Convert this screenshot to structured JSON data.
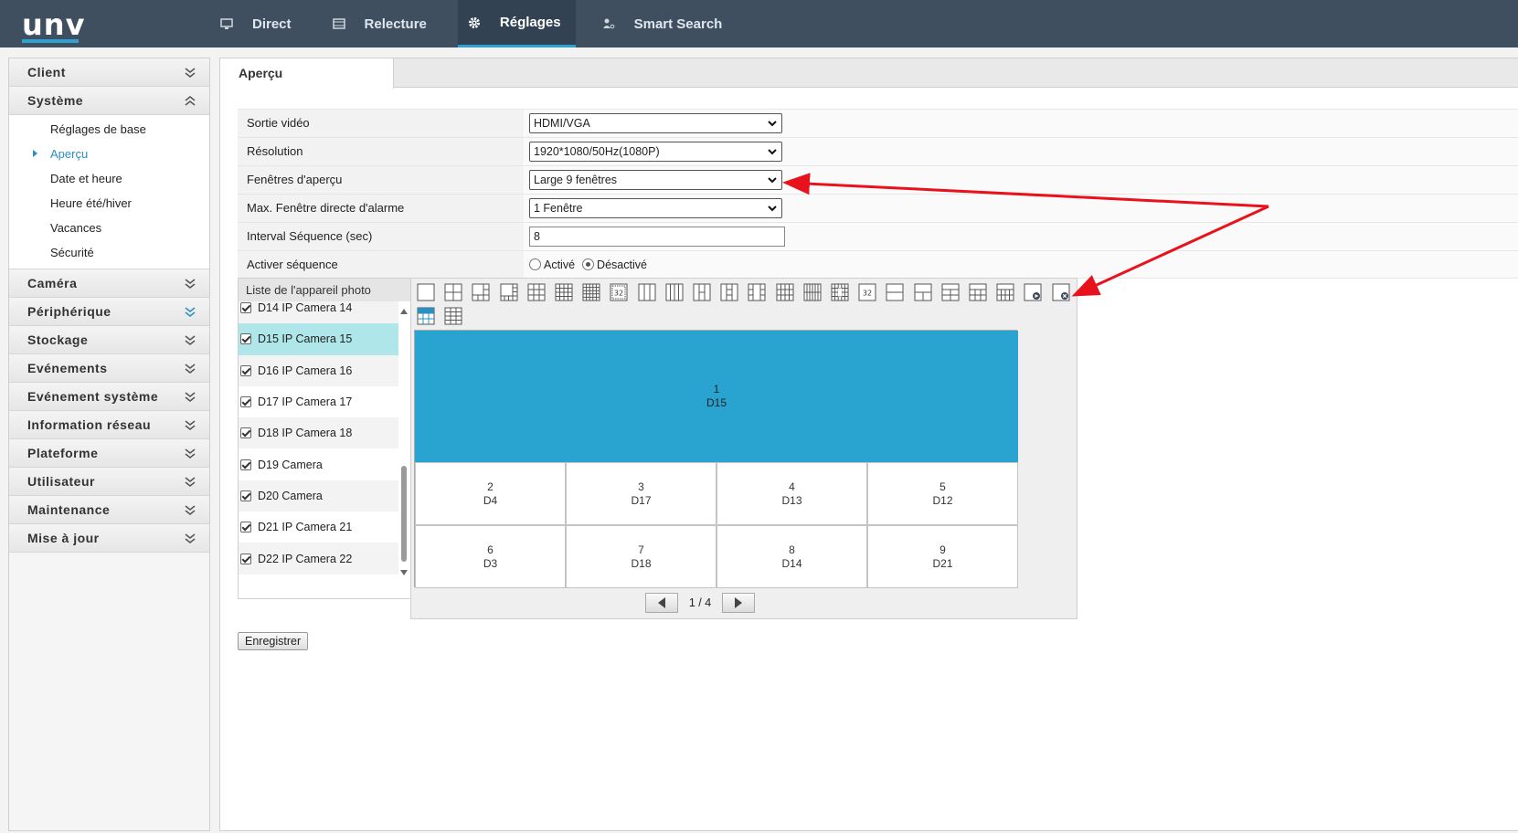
{
  "brand": {
    "logo": "unv"
  },
  "nav": [
    {
      "label": "Direct",
      "icon": "monitor-icon"
    },
    {
      "label": "Relecture",
      "icon": "film-icon"
    },
    {
      "label": "Réglages",
      "icon": "gear-icon"
    },
    {
      "label": "Smart Search",
      "icon": "person-search-icon"
    }
  ],
  "sidebar": {
    "client": "Client",
    "systeme": "Système",
    "sub": [
      "Réglages de base",
      "Aperçu",
      "Date et heure",
      "Heure été/hiver",
      "Vacances",
      "Sécurité"
    ],
    "rest": [
      "Caméra",
      "Périphérique",
      "Stockage",
      "Evénements",
      "Evénement système",
      "Information réseau",
      "Plateforme",
      "Utilisateur",
      "Maintenance",
      "Mise à jour"
    ]
  },
  "tab": {
    "label": "Aperçu"
  },
  "form": {
    "rows": [
      {
        "label": "Sortie vidéo",
        "value": "HDMI/VGA"
      },
      {
        "label": "Résolution",
        "value": "1920*1080/50Hz(1080P)"
      },
      {
        "label": "Fenêtres d'aperçu",
        "value": "Large 9 fenêtres"
      },
      {
        "label": "Max. Fenêtre directe d'alarme",
        "value": "1 Fenêtre"
      },
      {
        "label": "Interval Séquence (sec)",
        "value": "8"
      },
      {
        "label": "Activer séquence",
        "on": "Activé",
        "off": "Désactivé"
      }
    ]
  },
  "camlist": {
    "title": "Liste de l'appareil photo",
    "items": [
      "D14 IP Camera 14",
      "D15 IP Camera 15",
      "D16 IP Camera 16",
      "D17 IP Camera 17",
      "D18 IP Camera 18",
      "D19 Camera",
      "D20 Camera",
      "D21 IP Camera 21",
      "D22 IP Camera 22"
    ]
  },
  "grid": {
    "cells": [
      {
        "n": "1",
        "d": "D15"
      },
      {
        "n": "2",
        "d": "D4"
      },
      {
        "n": "3",
        "d": "D17"
      },
      {
        "n": "4",
        "d": "D13"
      },
      {
        "n": "5",
        "d": "D12"
      },
      {
        "n": "6",
        "d": "D3"
      },
      {
        "n": "7",
        "d": "D18"
      },
      {
        "n": "8",
        "d": "D14"
      },
      {
        "n": "9",
        "d": "D21"
      }
    ],
    "layout_label_32": "32"
  },
  "pager": {
    "text": "1 / 4"
  },
  "save": {
    "label": "Enregistrer"
  },
  "colors": {
    "topbar": "#3f4f60",
    "accent": "#2ea3d1",
    "big_cell": "#29a3cf",
    "selected_row": "#aee6ea",
    "annotation": "#e8121c"
  }
}
